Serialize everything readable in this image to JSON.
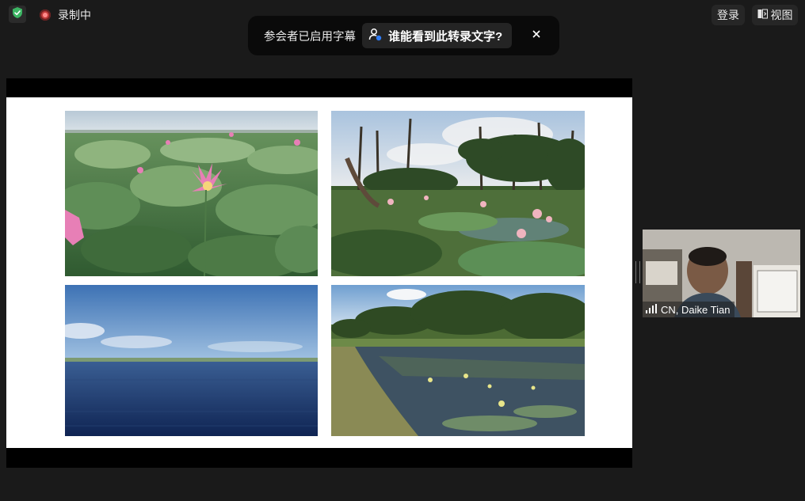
{
  "status": {
    "recording_label": "录制中",
    "icons": {
      "shield": "shield-check-icon",
      "recording": "recording-icon"
    }
  },
  "topbar": {
    "login_label": "登录",
    "view_label": "视图",
    "view_icon": "view-layout-icon"
  },
  "caption_notice": {
    "text": "参会者已启用字幕",
    "link_label": "谁能看到此转录文字?",
    "link_icon": "participant-icon",
    "close_icon": "close-icon"
  },
  "shared_screen": {
    "photos": [
      {
        "name": "lotus-flowers-photo"
      },
      {
        "name": "forest-lotus-photo"
      },
      {
        "name": "lake-photo"
      },
      {
        "name": "pond-photo"
      }
    ]
  },
  "participant": {
    "name": "CN, Daike Tian",
    "icon": "signal-strength-icon"
  },
  "colors": {
    "background": "#1a1a1a",
    "notice_bg": "#0a0a0a",
    "shield_green": "#3cb563",
    "recording_red": "#c13a3a"
  }
}
